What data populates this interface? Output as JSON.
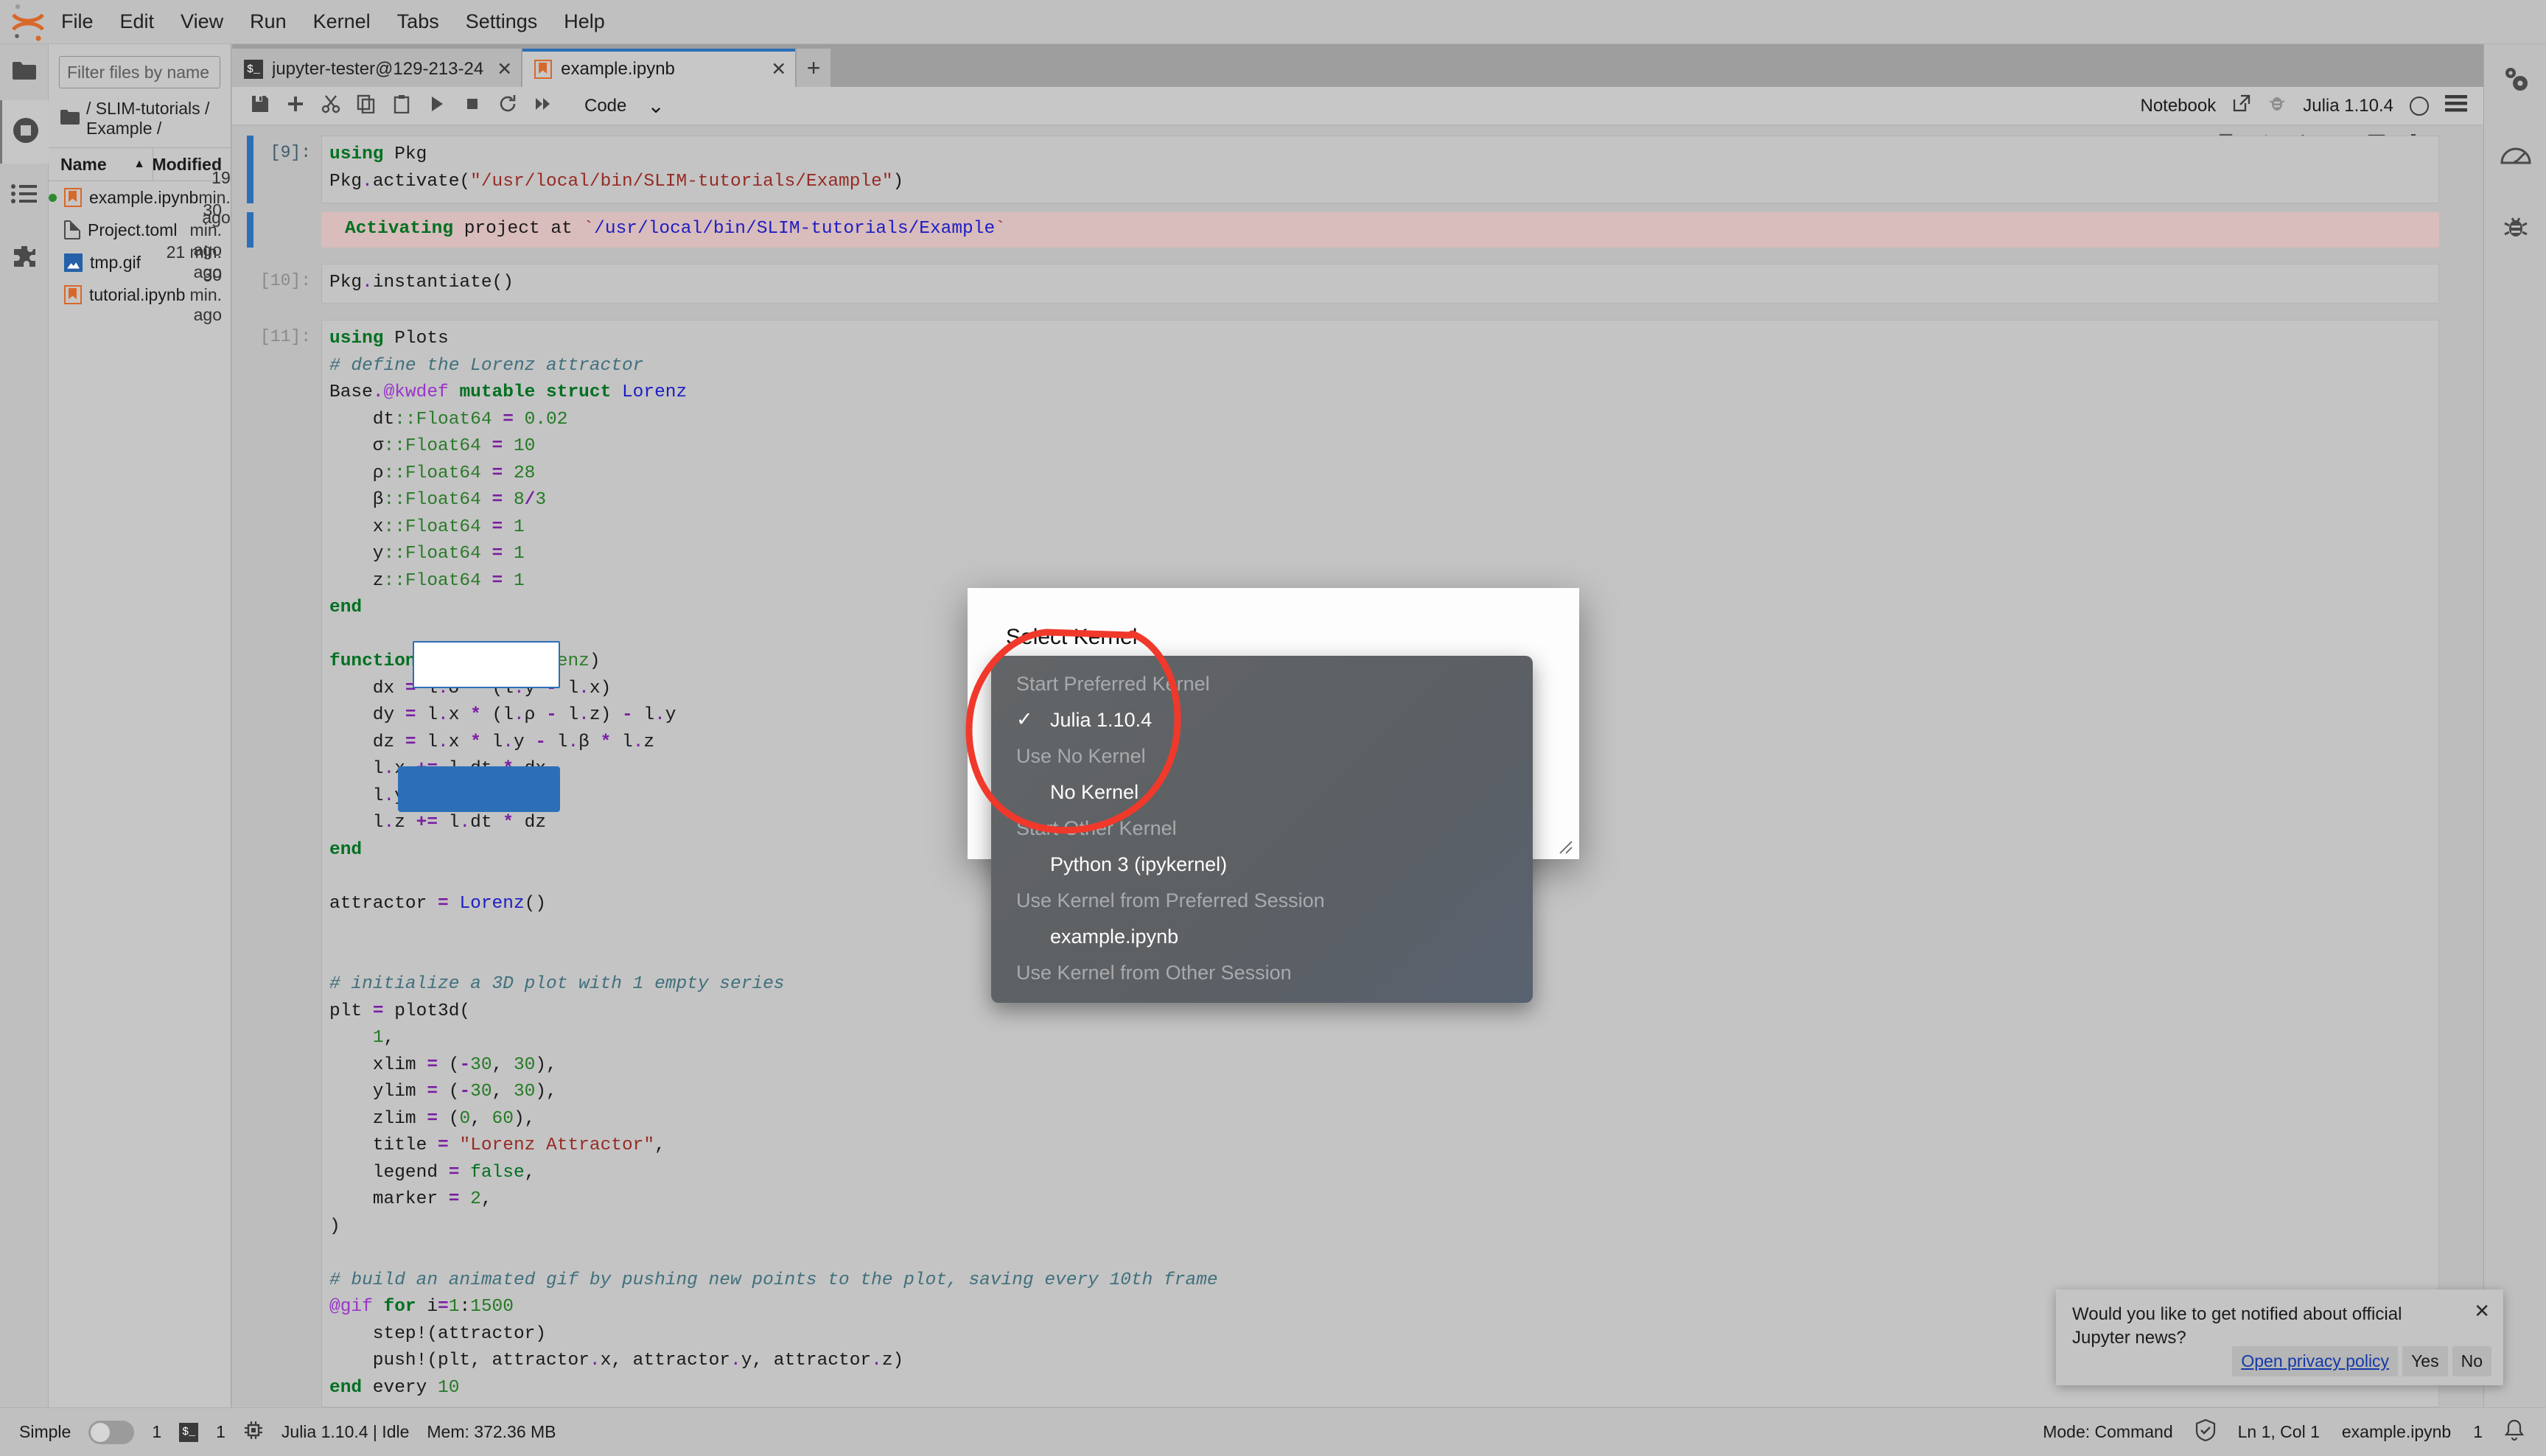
{
  "app": {
    "name": "JupyterLab"
  },
  "menubar": {
    "items": [
      "File",
      "Edit",
      "View",
      "Run",
      "Kernel",
      "Tabs",
      "Settings",
      "Help"
    ]
  },
  "left_activity_bar": {
    "items": [
      {
        "icon": "folder-icon",
        "name": "file-browser"
      },
      {
        "icon": "running-terminals-icon",
        "name": "running-sessions"
      },
      {
        "icon": "table-of-contents-icon",
        "name": "table-of-contents"
      },
      {
        "icon": "extension-puzzle-icon",
        "name": "extension-manager"
      }
    ]
  },
  "right_activity_bar": {
    "items": [
      {
        "icon": "property-inspector-gears-icon",
        "name": "property-inspector"
      },
      {
        "icon": "gauge-icon",
        "name": "dashboard"
      },
      {
        "icon": "bug-icon",
        "name": "debugger"
      }
    ]
  },
  "file_browser": {
    "search": {
      "placeholder": "Filter files by name",
      "value": ""
    },
    "breadcrumb": "/ SLIM-tutorials / Example /",
    "columns": {
      "name": "Name",
      "modified": "Modified"
    },
    "sort_arrow": "▲",
    "files": [
      {
        "name": "example.ipynb",
        "modified": "19 min. ago",
        "icon": "notebook-icon",
        "running": true
      },
      {
        "name": "Project.toml",
        "modified": "30 min. ago",
        "icon": "file-icon",
        "running": false
      },
      {
        "name": "tmp.gif",
        "modified": "21 min. ago",
        "icon": "image-icon",
        "running": false
      },
      {
        "name": "tutorial.ipynb",
        "modified": "30 min. ago",
        "icon": "notebook-icon",
        "running": false
      }
    ]
  },
  "tabs": [
    {
      "label": "jupyter-tester@129-213-24",
      "icon": "terminal-icon",
      "active": false,
      "close": "✕"
    },
    {
      "label": "example.ipynb",
      "icon": "notebook-icon",
      "active": true,
      "close": "✕"
    }
  ],
  "tab_add_label": "+",
  "notebook_toolbar": {
    "buttons": [
      "save-icon",
      "insert-cell-icon",
      "cut-icon",
      "copy-icon",
      "paste-icon",
      "run-icon",
      "stop-icon",
      "restart-icon",
      "restart-run-all-icon"
    ],
    "cell_type": "Code",
    "cell_type_chevron": "⌄",
    "right": {
      "notebook_label": "Notebook",
      "external_link_icon": "external-link-icon",
      "debugger_icon": "bug-icon",
      "kernel_name": "Julia 1.10.4",
      "kernel_status_icon": "kernel-idle-circle-icon",
      "menu_icon": "hamburger-menu-icon"
    }
  },
  "cell_actions": [
    "duplicate-cell-icon",
    "move-cell-up-icon",
    "move-cell-down-icon",
    "insert-cell-above-icon",
    "insert-cell-below-icon",
    "delete-cell-icon"
  ],
  "cells": [
    {
      "prompt": "[9]:",
      "code_html": "<span class=\"kw\">using</span> Pkg\nPkg<span class=\"dot\">.</span>activate(<span class=\"str\">\"/usr/local/bin/SLIM-tutorials/Example\"</span>)",
      "output_html": "<span class=\"kw\">Activating</span> project at <span class=\"str\">`</span><span class=\"typ\">/usr/local/bin/SLIM-tutorials/Example</span><span class=\"str\">`</span>"
    },
    {
      "prompt": "[10]:",
      "code_html": "Pkg<span class=\"dot\">.</span>instantiate()",
      "output_html": ""
    },
    {
      "prompt": "[11]:",
      "code_html": "<span class=\"kw\">using</span> Plots\n<span class=\"cmt\"># define the Lorenz attractor</span>\nBase<span class=\"dot\">.</span><span class=\"mac\">@kwdef</span> <span class=\"kw\">mutable struct</span> <span class=\"typ\">Lorenz</span>\n    dt<span class=\"grn\">::Float64</span> <span class=\"op\">=</span> <span class=\"num\">0.02</span>\n    σ<span class=\"grn\">::Float64</span> <span class=\"op\">=</span> <span class=\"num\">10</span>\n    ρ<span class=\"grn\">::Float64</span> <span class=\"op\">=</span> <span class=\"num\">28</span>\n    β<span class=\"grn\">::Float64</span> <span class=\"op\">=</span> <span class=\"num\">8</span><span class=\"op\">/</span><span class=\"num\">3</span>\n    x<span class=\"grn\">::Float64</span> <span class=\"op\">=</span> <span class=\"num\">1</span>\n    y<span class=\"grn\">::Float64</span> <span class=\"op\">=</span> <span class=\"num\">1</span>\n    z<span class=\"grn\">::Float64</span> <span class=\"op\">=</span> <span class=\"num\">1</span>\n<span class=\"kw\">end</span>\n\n<span class=\"kw\">function</span> <span class=\"fn\">step!</span>(l<span class=\"grn\">::Lorenz</span>)\n    dx <span class=\"op\">=</span> l<span class=\"dot\">.</span>σ <span class=\"op\">*</span> (l<span class=\"dot\">.</span>y <span class=\"op\">-</span> l<span class=\"dot\">.</span>x)\n    dy <span class=\"op\">=</span> l<span class=\"dot\">.</span>x <span class=\"op\">*</span> (l<span class=\"dot\">.</span>ρ <span class=\"op\">-</span> l<span class=\"dot\">.</span>z) <span class=\"op\">-</span> l<span class=\"dot\">.</span>y\n    dz <span class=\"op\">=</span> l<span class=\"dot\">.</span>x <span class=\"op\">*</span> l<span class=\"dot\">.</span>y <span class=\"op\">-</span> l<span class=\"dot\">.</span>β <span class=\"op\">*</span> l<span class=\"dot\">.</span>z\n    l<span class=\"dot\">.</span>x <span class=\"op\">+=</span> l<span class=\"dot\">.</span>dt <span class=\"op\">*</span> dx\n    l<span class=\"dot\">.</span>y <span class=\"op\">+=</span> l<span class=\"dot\">.</span>dt <span class=\"op\">*</span> dy\n    l<span class=\"dot\">.</span>z <span class=\"op\">+=</span> l<span class=\"dot\">.</span>dt <span class=\"op\">*</span> dz\n<span class=\"kw\">end</span>\n\nattractor <span class=\"op\">=</span> <span class=\"typ\">Lorenz</span>()\n\n\n<span class=\"cmt\"># initialize a 3D plot with 1 empty series</span>\nplt <span class=\"op\">=</span> plot3d(\n    <span class=\"num\">1</span>,\n    xlim <span class=\"op\">=</span> (<span class=\"op\">-</span><span class=\"num\">30</span>, <span class=\"num\">30</span>),\n    ylim <span class=\"op\">=</span> (<span class=\"op\">-</span><span class=\"num\">30</span>, <span class=\"num\">30</span>),\n    zlim <span class=\"op\">=</span> (<span class=\"num\">0</span>, <span class=\"num\">60</span>),\n    title <span class=\"op\">=</span> <span class=\"str\">\"Lorenz Attractor\"</span>,\n    legend <span class=\"op\">=</span> <span class=\"kw2\">false</span>,\n    marker <span class=\"op\">=</span> <span class=\"num\">2</span>,\n)\n\n<span class=\"cmt\"># build an animated gif by pushing new points to the plot, saving every 10th frame</span>\n<span class=\"mac\">@gif</span> <span class=\"kw\">for</span> i<span class=\"op\">=</span><span class=\"num\">1</span>:<span class=\"num\">1500</span>\n    step!(attractor)\n    push!(plt, attractor<span class=\"dot\">.</span>x, attractor<span class=\"dot\">.</span>y, attractor<span class=\"dot\">.</span>z)\n<span class=\"kw\">end</span> every <span class=\"num\">10</span>",
      "output_html": ""
    }
  ],
  "dialog": {
    "title": "Select Kernel",
    "select_value": "",
    "ok_label": "",
    "resize_icon": "resize-handle-icon"
  },
  "kernel_menu": {
    "groups": [
      {
        "header": "Start Preferred Kernel",
        "items": [
          {
            "label": "Julia 1.10.4",
            "checked": true,
            "check": "✓"
          }
        ]
      },
      {
        "header": "Use No Kernel",
        "items": [
          {
            "label": "No Kernel",
            "checked": false,
            "check": ""
          }
        ]
      },
      {
        "header": "Start Other Kernel",
        "items": [
          {
            "label": "Python 3 (ipykernel)",
            "checked": false,
            "check": ""
          }
        ]
      },
      {
        "header": "Use Kernel from Preferred Session",
        "items": [
          {
            "label": "example.ipynb",
            "checked": false,
            "check": ""
          }
        ]
      },
      {
        "header": "Use Kernel from Other Session",
        "items": []
      }
    ]
  },
  "annotation": {
    "shape": "hand-drawn-red-circle",
    "color": "#f0392b"
  },
  "toast": {
    "message": "Would you like to get notified about official Jupyter news?",
    "close": "✕",
    "link_label": "Open privacy policy",
    "yes_label": "Yes",
    "no_label": "No"
  },
  "statusbar": {
    "simple_label": "Simple",
    "terminal_count": "1",
    "terminal_icon": "terminal-icon",
    "kernel_count": "1",
    "kernel_icon": "cpu-chip-icon",
    "kernel_status": "Julia 1.10.4 | Idle",
    "memory": "Mem: 372.36 MB",
    "mode": "Mode: Command",
    "trust_icon": "shield-check-icon",
    "position": "Ln 1, Col 1",
    "filename": "example.ipynb",
    "notification_count": "1",
    "bell_icon": "bell-icon"
  },
  "colors": {
    "accent": "#2c6fb8",
    "notebook_orange": "#d8682a",
    "running_green": "#2d8a2d",
    "annotation_red": "#f0392b",
    "output_error_bg": "#d9bcbc"
  }
}
